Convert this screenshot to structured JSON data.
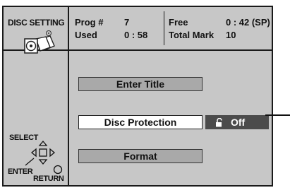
{
  "sidebar": {
    "title": "DISC SETTING",
    "disc_icon": "disc-stack-icon"
  },
  "header": {
    "prog_label": "Prog #",
    "prog_value": "7",
    "used_label": "Used",
    "used_value": "0 : 58",
    "free_label": "Free",
    "free_value": "0 : 42 (SP)",
    "total_label": "Total Mark",
    "total_value": "10"
  },
  "menu": {
    "items": [
      {
        "label": "Enter Title"
      },
      {
        "label": "Disc Protection",
        "status": "Off",
        "status_icon": "unlocked-padlock-icon"
      },
      {
        "label": "Format"
      }
    ]
  },
  "nav": {
    "select": "SELECT",
    "enter": "ENTER",
    "return": "RETURN"
  },
  "colors": {
    "panel": "#c7c7c7",
    "button": "#a9a9a9",
    "selected": "#ffffff",
    "status_bg": "#4b4b4b"
  }
}
